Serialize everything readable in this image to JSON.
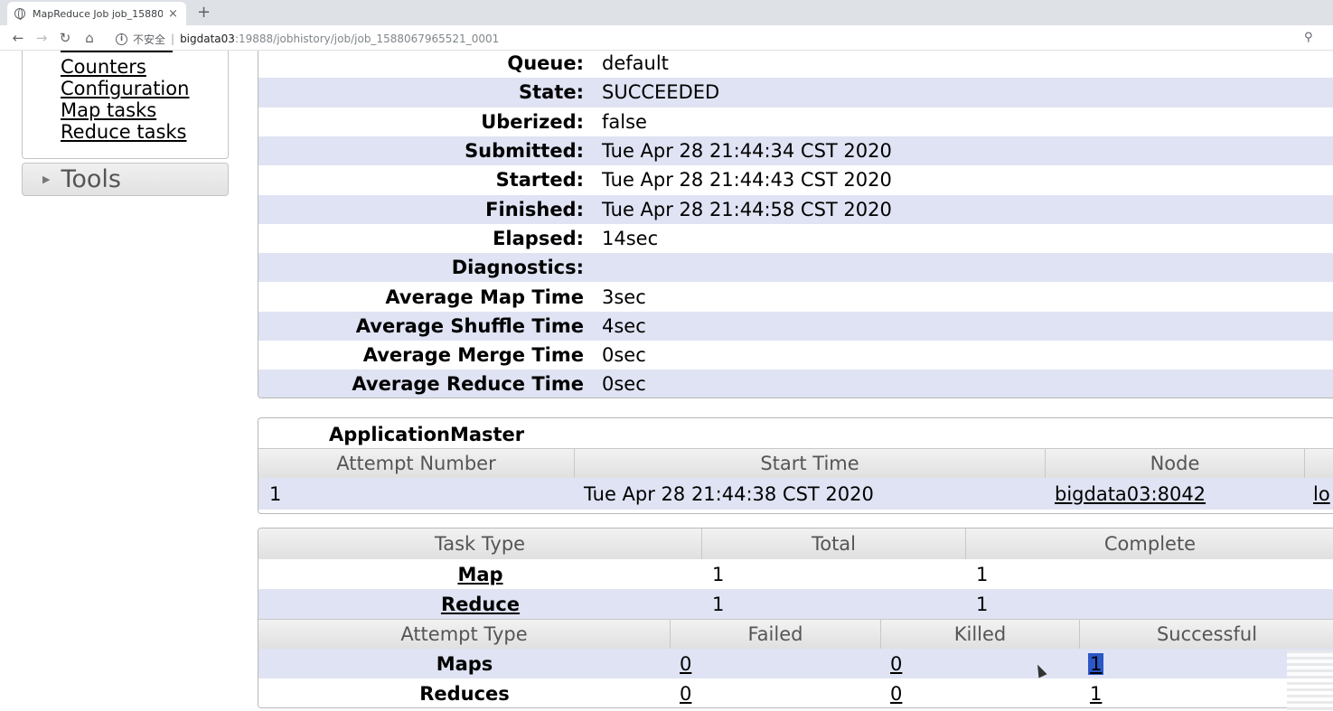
{
  "browser": {
    "tab_title": "MapReduce Job job_1588067965521_0001",
    "close_glyph": "×",
    "new_tab_glyph": "+",
    "insecure_label": "不安全",
    "url_host": "bigdata03",
    "url_path": ":19888/jobhistory/job/job_1588067965521_0001"
  },
  "sidebar": {
    "links": [
      "Counters",
      "Configuration",
      "Map tasks",
      "Reduce tasks"
    ],
    "tools_label": "Tools"
  },
  "job_info": [
    {
      "key": "Queue:",
      "value": "default"
    },
    {
      "key": "State:",
      "value": "SUCCEEDED"
    },
    {
      "key": "Uberized:",
      "value": "false"
    },
    {
      "key": "Submitted:",
      "value": "Tue Apr 28 21:44:34 CST 2020"
    },
    {
      "key": "Started:",
      "value": "Tue Apr 28 21:44:43 CST 2020"
    },
    {
      "key": "Finished:",
      "value": "Tue Apr 28 21:44:58 CST 2020"
    },
    {
      "key": "Elapsed:",
      "value": "14sec"
    },
    {
      "key": "Diagnostics:",
      "value": ""
    },
    {
      "key": "Average Map Time",
      "value": "3sec"
    },
    {
      "key": "Average Shuffle Time",
      "value": "4sec"
    },
    {
      "key": "Average Merge Time",
      "value": "0sec"
    },
    {
      "key": "Average Reduce Time",
      "value": "0sec"
    }
  ],
  "app_master": {
    "title": "ApplicationMaster",
    "headers": [
      "Attempt Number",
      "Start Time",
      "Node"
    ],
    "row": {
      "attempt": "1",
      "start_time": "Tue Apr 28 21:44:38 CST 2020",
      "node": "bigdata03:8042",
      "logs": "lo"
    }
  },
  "tasks": {
    "headers": [
      "Task Type",
      "Total",
      "Complete"
    ],
    "rows": [
      {
        "type": "Map",
        "total": "1",
        "complete": "1"
      },
      {
        "type": "Reduce",
        "total": "1",
        "complete": "1"
      }
    ]
  },
  "attempts": {
    "headers": [
      "Attempt Type",
      "Failed",
      "Killed",
      "Successful"
    ],
    "rows": [
      {
        "type": "Maps",
        "failed": "0",
        "killed": "0",
        "successful": "1"
      },
      {
        "type": "Reduces",
        "failed": "0",
        "killed": "0",
        "successful": "1"
      }
    ]
  }
}
